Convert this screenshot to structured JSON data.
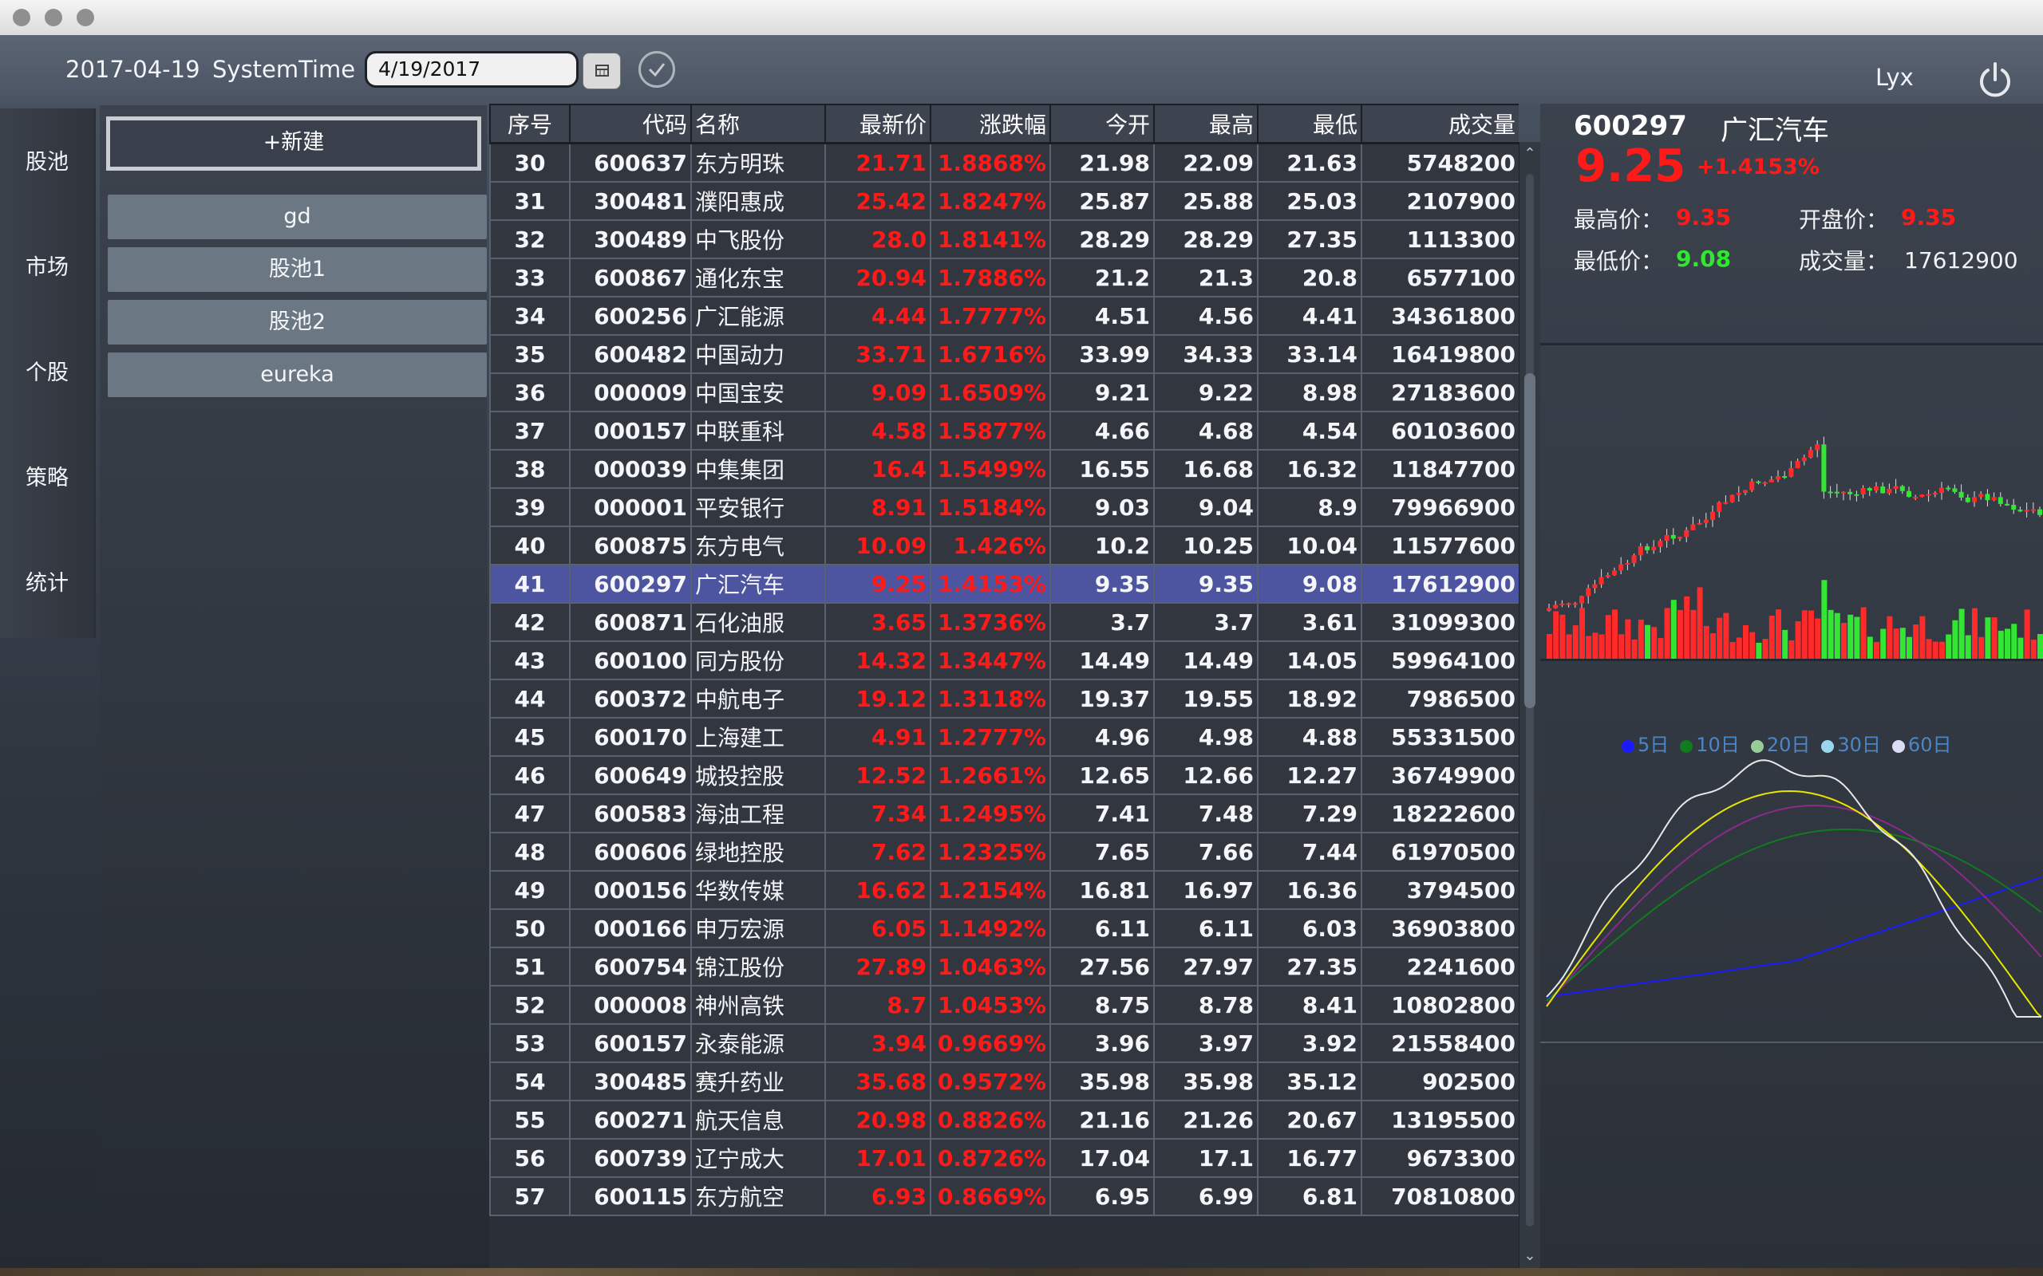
{
  "header": {
    "date": "2017-04-19",
    "system_time_label": "SystemTime",
    "date_input_value": "4/19/2017",
    "user": "Lyx"
  },
  "nav": [
    "股池",
    "市场",
    "个股",
    "策略",
    "统计"
  ],
  "pool": {
    "new_button": "+新建",
    "items": [
      "gd",
      "股池1",
      "股池2",
      "eureka"
    ]
  },
  "table": {
    "columns": [
      "序号",
      "代码",
      "名称",
      "最新价",
      "涨跌幅",
      "今开",
      "最高",
      "最低",
      "成交量"
    ],
    "selected_seq": "41",
    "rows": [
      [
        "30",
        "600637",
        "东方明珠",
        "21.71",
        "1.8868%",
        "21.98",
        "22.09",
        "21.63",
        "5748200"
      ],
      [
        "31",
        "300481",
        "濮阳惠成",
        "25.42",
        "1.8247%",
        "25.87",
        "25.88",
        "25.03",
        "2107900"
      ],
      [
        "32",
        "300489",
        "中飞股份",
        "28.0",
        "1.8141%",
        "28.29",
        "28.29",
        "27.35",
        "1113300"
      ],
      [
        "33",
        "600867",
        "通化东宝",
        "20.94",
        "1.7886%",
        "21.2",
        "21.3",
        "20.8",
        "6577100"
      ],
      [
        "34",
        "600256",
        "广汇能源",
        "4.44",
        "1.7777%",
        "4.51",
        "4.56",
        "4.41",
        "34361800"
      ],
      [
        "35",
        "600482",
        "中国动力",
        "33.71",
        "1.6716%",
        "33.99",
        "34.33",
        "33.14",
        "16419800"
      ],
      [
        "36",
        "000009",
        "中国宝安",
        "9.09",
        "1.6509%",
        "9.21",
        "9.22",
        "8.98",
        "27183600"
      ],
      [
        "37",
        "000157",
        "中联重科",
        "4.58",
        "1.5877%",
        "4.66",
        "4.68",
        "4.54",
        "60103600"
      ],
      [
        "38",
        "000039",
        "中集集团",
        "16.4",
        "1.5499%",
        "16.55",
        "16.68",
        "16.32",
        "11847700"
      ],
      [
        "39",
        "000001",
        "平安银行",
        "8.91",
        "1.5184%",
        "9.03",
        "9.04",
        "8.9",
        "79966900"
      ],
      [
        "40",
        "600875",
        "东方电气",
        "10.09",
        "1.426%",
        "10.2",
        "10.25",
        "10.04",
        "11577600"
      ],
      [
        "41",
        "600297",
        "广汇汽车",
        "9.25",
        "1.4153%",
        "9.35",
        "9.35",
        "9.08",
        "17612900"
      ],
      [
        "42",
        "600871",
        "石化油服",
        "3.65",
        "1.3736%",
        "3.7",
        "3.7",
        "3.61",
        "31099300"
      ],
      [
        "43",
        "600100",
        "同方股份",
        "14.32",
        "1.3447%",
        "14.49",
        "14.49",
        "14.05",
        "59964100"
      ],
      [
        "44",
        "600372",
        "中航电子",
        "19.12",
        "1.3118%",
        "19.37",
        "19.55",
        "18.92",
        "7986500"
      ],
      [
        "45",
        "600170",
        "上海建工",
        "4.91",
        "1.2777%",
        "4.96",
        "4.98",
        "4.88",
        "55331500"
      ],
      [
        "46",
        "600649",
        "城投控股",
        "12.52",
        "1.2661%",
        "12.65",
        "12.66",
        "12.27",
        "36749900"
      ],
      [
        "47",
        "600583",
        "海油工程",
        "7.34",
        "1.2495%",
        "7.41",
        "7.48",
        "7.29",
        "18222600"
      ],
      [
        "48",
        "600606",
        "绿地控股",
        "7.62",
        "1.2325%",
        "7.65",
        "7.66",
        "7.44",
        "61970500"
      ],
      [
        "49",
        "000156",
        "华数传媒",
        "16.62",
        "1.2154%",
        "16.81",
        "16.97",
        "16.36",
        "3794500"
      ],
      [
        "50",
        "000166",
        "申万宏源",
        "6.05",
        "1.1492%",
        "6.11",
        "6.11",
        "6.03",
        "36903800"
      ],
      [
        "51",
        "600754",
        "锦江股份",
        "27.89",
        "1.0463%",
        "27.56",
        "27.97",
        "27.35",
        "2241600"
      ],
      [
        "52",
        "000008",
        "神州高铁",
        "8.7",
        "1.0453%",
        "8.75",
        "8.78",
        "8.41",
        "10802800"
      ],
      [
        "53",
        "600157",
        "永泰能源",
        "3.94",
        "0.9669%",
        "3.96",
        "3.97",
        "3.92",
        "21558400"
      ],
      [
        "54",
        "300485",
        "赛升药业",
        "35.68",
        "0.9572%",
        "35.98",
        "35.98",
        "35.12",
        "902500"
      ],
      [
        "55",
        "600271",
        "航天信息",
        "20.98",
        "0.8826%",
        "21.16",
        "21.26",
        "20.67",
        "13195500"
      ],
      [
        "56",
        "600739",
        "辽宁成大",
        "17.01",
        "0.8726%",
        "17.04",
        "17.1",
        "16.77",
        "9673300"
      ],
      [
        "57",
        "600115",
        "东方航空",
        "6.93",
        "0.8669%",
        "6.95",
        "6.99",
        "6.81",
        "70810800"
      ]
    ]
  },
  "stock": {
    "code": "600297",
    "name": "广汇汽车",
    "price": "9.25",
    "change": "+1.4153%",
    "high_label": "最高价：",
    "high": "9.35",
    "open_label": "开盘价：",
    "open": "9.35",
    "low_label": "最低价：",
    "low": "9.08",
    "volume_label": "成交量：",
    "volume": "17612900"
  },
  "ma_legend": [
    {
      "label": "5日",
      "color": "#1a1aff"
    },
    {
      "label": "10日",
      "color": "#127a1f"
    },
    {
      "label": "20日",
      "color": "#9acc9a"
    },
    {
      "label": "30日",
      "color": "#9ad6f0"
    },
    {
      "label": "60日",
      "color": "#dcdcf5"
    }
  ],
  "colors": {
    "up": "#ff2a2a",
    "down": "#33e633",
    "selected_row": "#4e55a0"
  }
}
